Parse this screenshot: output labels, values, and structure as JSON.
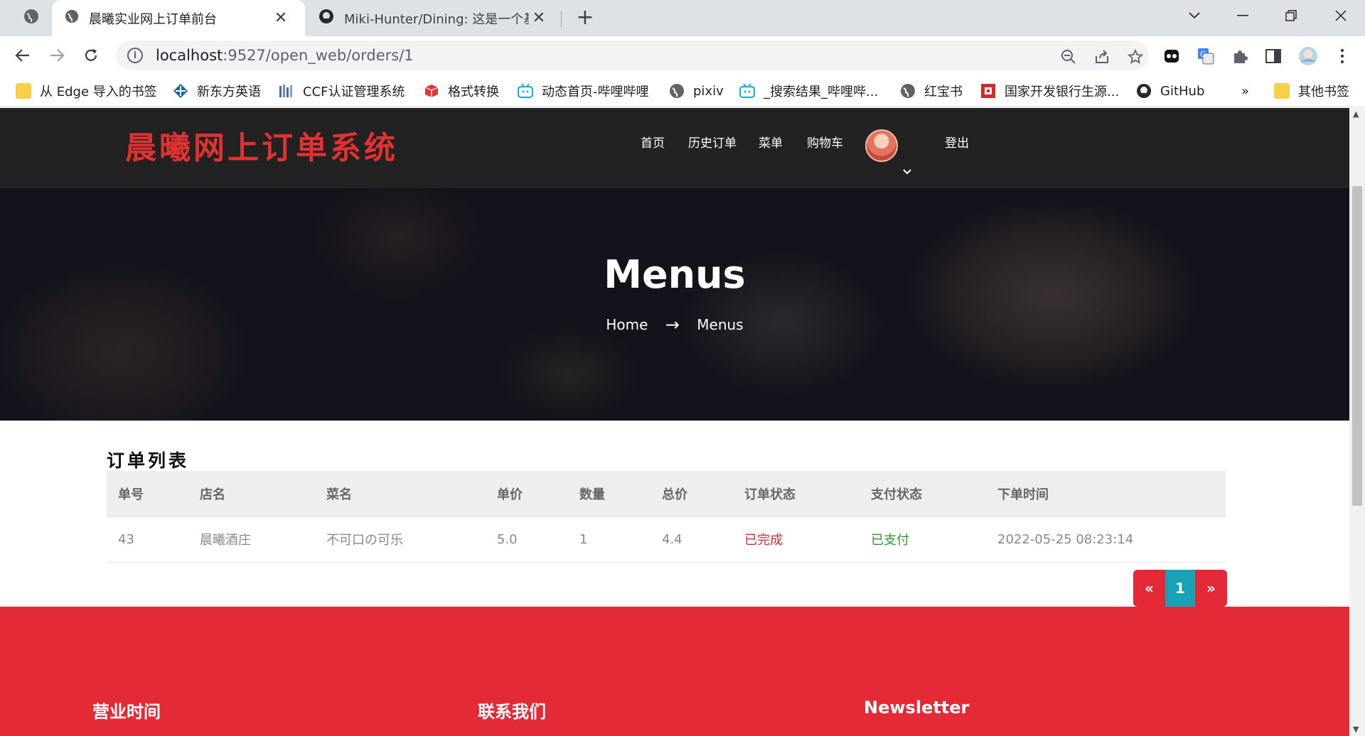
{
  "browser": {
    "tabs": [
      {
        "title": "晨曦实业网上订单前台",
        "active": true
      },
      {
        "title": "Miki-Hunter/Dining: 这是一个基",
        "active": false
      }
    ],
    "close_glyph": "✕",
    "new_tab_glyph": "+",
    "url_host": "localhost",
    "url_rest": ":9527/open_web/orders/1",
    "bookmarks": [
      {
        "label": "从 Edge 导入的书签",
        "icon": "folder-icon"
      },
      {
        "label": "新东方英语",
        "icon": "site-icon"
      },
      {
        "label": "CCF认证管理系统",
        "icon": "site-icon"
      },
      {
        "label": "格式转换",
        "icon": "site-icon"
      },
      {
        "label": "动态首页-哔哩哔哩",
        "icon": "bilibili-icon"
      },
      {
        "label": "pixiv",
        "icon": "globe-icon"
      },
      {
        "label": "_搜索结果_哔哩哔...",
        "icon": "bilibili-icon"
      },
      {
        "label": "红宝书",
        "icon": "globe-icon"
      },
      {
        "label": "国家开发银行生源...",
        "icon": "site-icon"
      },
      {
        "label": "GitHub",
        "icon": "github-icon"
      },
      {
        "label": "»",
        "icon": ""
      },
      {
        "label": "其他书签",
        "icon": "folder-icon"
      }
    ]
  },
  "site": {
    "logo": "晨曦网上订单系统",
    "nav": [
      "首页",
      "历史订单",
      "菜单",
      "购物车",
      "登出"
    ]
  },
  "hero": {
    "title": "Menus",
    "crumb_home": "Home",
    "crumb_arrow": "→",
    "crumb_current": "Menus"
  },
  "orders": {
    "title": "订单列表",
    "headers": [
      "单号",
      "店名",
      "菜名",
      "单价",
      "数量",
      "总价",
      "订单状态",
      "支付状态",
      "下单时间"
    ],
    "rows": [
      [
        "43",
        "晨曦酒庄",
        "不可口の可乐",
        "5.0",
        "1",
        "4.4",
        "已完成",
        "已支付",
        "2022-05-25 08:23:14"
      ]
    ]
  },
  "pagination": {
    "prev": "«",
    "current": "1",
    "next": "»"
  },
  "footer": {
    "headings": [
      "营业时间",
      "联系我们",
      "Newsletter"
    ]
  },
  "colors": {
    "accent_red": "#e32a36",
    "pager_active": "#17a2b8",
    "status_done": "#e0283a",
    "status_paid": "#2d9a2d",
    "header_bg": "#222222"
  }
}
